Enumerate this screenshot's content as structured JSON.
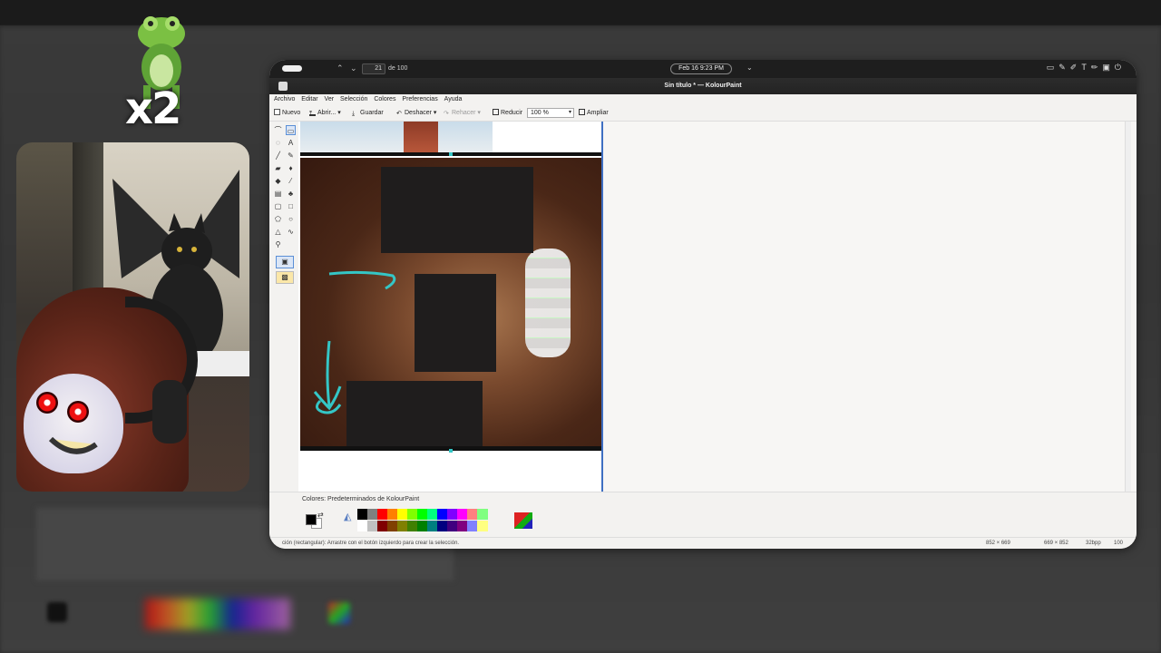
{
  "overlay": {
    "multiplier": "x2"
  },
  "sysbar": {
    "page_current": "21",
    "page_total": "de 100",
    "clock": "Feb 16   9:23 PM",
    "tray_icons": [
      "chat-icon",
      "pen-icon",
      "pen-icon",
      "text-icon",
      "pencil-icon",
      "window-icon",
      "power-icon"
    ]
  },
  "window": {
    "title": "Sin título * — KolourPaint"
  },
  "menu": {
    "items": [
      "Archivo",
      "Editar",
      "Ver",
      "Selección",
      "Colores",
      "Preferencias",
      "Ayuda"
    ]
  },
  "toolbar": {
    "new_label": "Nuevo",
    "open_label": "Abrir...",
    "save_label": "Guardar",
    "undo_label": "Deshacer",
    "redo_label": "Rehacer",
    "zoom_out_label": "Reducir",
    "zoom_value": "100 %",
    "zoom_in_label": "Ampliar"
  },
  "palette": {
    "label": "Colores: Predeterminados de KolourPaint",
    "row1": [
      "#000000",
      "#808080",
      "#ff0000",
      "#ff8000",
      "#ffff00",
      "#80ff00",
      "#00ff00",
      "#00ff80",
      "#0000ff",
      "#8000ff",
      "#ff00ff",
      "#ff8080",
      "#80ff80"
    ],
    "row2": [
      "#ffffff",
      "#c0c0c0",
      "#800000",
      "#804000",
      "#808000",
      "#408000",
      "#008000",
      "#008080",
      "#000080",
      "#400080",
      "#800080",
      "#8080ff",
      "#ffff80"
    ]
  },
  "status": {
    "message": "ción (rectangular): Arrastre con el botón izquierdo para crear la selección.",
    "image_size": "852 × 669",
    "selection_size": "669 × 852",
    "depth": "32bpp",
    "zoom": "100"
  }
}
